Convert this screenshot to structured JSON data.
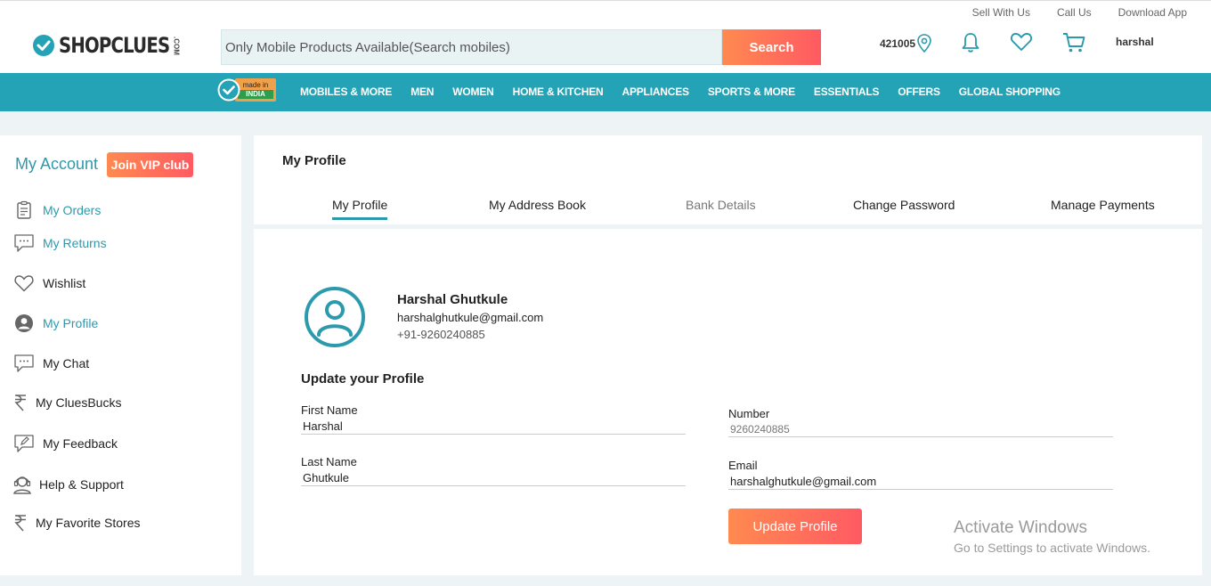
{
  "header": {
    "top_links": [
      "Sell With Us",
      "Call Us",
      "Download App"
    ],
    "logo_text": "SHOPCLUES",
    "logo_suffix": ".COM",
    "search_placeholder": "Only Mobile Products Available(Search mobiles)",
    "search_button": "Search",
    "pincode": "421005",
    "username": "harshal",
    "icons": [
      "location-pin-icon",
      "bell-icon",
      "heart-icon",
      "cart-icon"
    ]
  },
  "nav": {
    "badge_top": "made in",
    "badge_bottom": "INDIA",
    "items": [
      "MOBILES & MORE",
      "MEN",
      "WOMEN",
      "HOME & KITCHEN",
      "APPLIANCES",
      "SPORTS & MORE",
      "ESSENTIALS",
      "OFFERS",
      "GLOBAL SHOPPING"
    ]
  },
  "sidebar": {
    "title": "My Account",
    "vip_button": "Join VIP club",
    "items": [
      {
        "label": "My Orders",
        "icon": "clipboard-icon"
      },
      {
        "label": "My Returns",
        "icon": "chat-bubble-icon"
      },
      {
        "label": "Wishlist",
        "icon": "heart-icon"
      },
      {
        "label": "My Profile",
        "icon": "user-circle-icon"
      },
      {
        "label": "My Chat",
        "icon": "chat-bubble-icon"
      },
      {
        "label": "My CluesBucks",
        "icon": "rupee-icon"
      },
      {
        "label": "My Feedback",
        "icon": "edit-icon"
      },
      {
        "label": "Help & Support",
        "icon": "headset-icon"
      },
      {
        "label": "My Favorite Stores",
        "icon": "rupee-icon"
      }
    ]
  },
  "main": {
    "title": "My Profile",
    "tabs": [
      "My Profile",
      "My Address Book",
      "Bank Details",
      "Change Password",
      "Manage Payments"
    ],
    "profile": {
      "name": "Harshal Ghutkule",
      "email": "harshalghutkule@gmail.com",
      "phone": "+91-9260240885"
    },
    "form": {
      "heading": "Update your Profile",
      "first_name_label": "First Name",
      "first_name": "Harshal",
      "last_name_label": "Last Name",
      "last_name": "Ghutkule",
      "number_label": "Number",
      "number": "9260240885",
      "email_label": "Email",
      "email": "harshalghutkule@gmail.com",
      "submit": "Update Profile"
    }
  },
  "watermark": {
    "line1": "Activate Windows",
    "line2": "Go to Settings to activate Windows."
  },
  "colors": {
    "accent": "#2b9aad",
    "nav_bg": "#23a3b5",
    "button_gradient_start": "#ff8a50",
    "button_gradient_end": "#ff5a62"
  }
}
